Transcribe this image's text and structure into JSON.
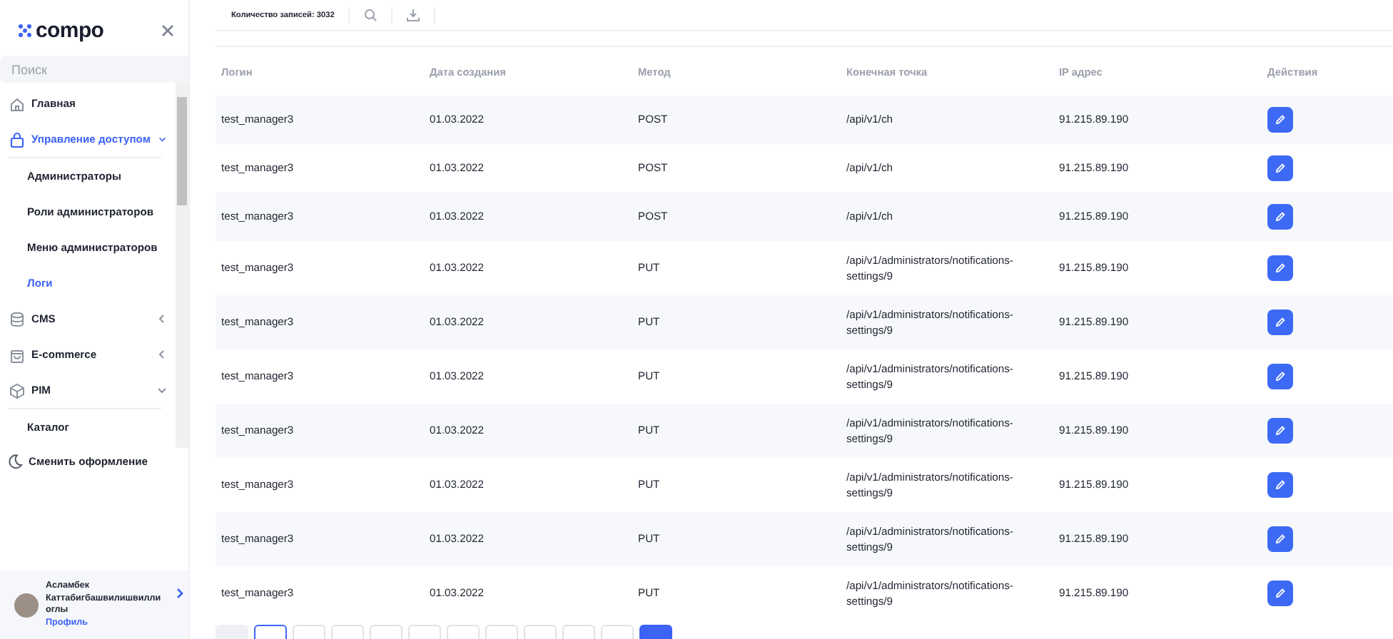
{
  "sidebar": {
    "logo": "compo",
    "search": {
      "placeholder": "Поиск"
    },
    "items": [
      {
        "label": "Главная",
        "selected": false
      },
      {
        "label": "Управление доступом",
        "selected": true,
        "expanded": true,
        "children": [
          {
            "label": "Администраторы",
            "selected": false
          },
          {
            "label": "Роли администраторов",
            "selected": false
          },
          {
            "label": "Меню администраторов",
            "selected": false
          },
          {
            "label": "Логи",
            "selected": true
          }
        ]
      },
      {
        "label": "CMS",
        "selected": false,
        "expanded": false
      },
      {
        "label": "E-commerce",
        "selected": false,
        "expanded": false
      },
      {
        "label": "PIM",
        "selected": false,
        "expanded": true,
        "children": [
          {
            "label": "Каталог",
            "selected": false
          }
        ]
      }
    ],
    "theme_toggle": "Сменить оформление",
    "profile": {
      "name": "Асламбек Каттабигбашвилишвилли оглы",
      "link": "Профиль"
    }
  },
  "toolbar": {
    "record_count": "Количество записей: 3032"
  },
  "table": {
    "columns": [
      "Логин",
      "Дата создания",
      "Метод",
      "Конечная точка",
      "IP адрес",
      "Действия"
    ],
    "rows": [
      [
        "test_manager3",
        "01.03.2022",
        "POST",
        "/api/v1/ch",
        "91.215.89.190"
      ],
      [
        "test_manager3",
        "01.03.2022",
        "POST",
        "/api/v1/ch",
        "91.215.89.190"
      ],
      [
        "test_manager3",
        "01.03.2022",
        "POST",
        "/api/v1/ch",
        "91.215.89.190"
      ],
      [
        "test_manager3",
        "01.03.2022",
        "PUT",
        "/api/v1/administrators/notifications-settings/9",
        "91.215.89.190"
      ],
      [
        "test_manager3",
        "01.03.2022",
        "PUT",
        "/api/v1/administrators/notifications-settings/9",
        "91.215.89.190"
      ],
      [
        "test_manager3",
        "01.03.2022",
        "PUT",
        "/api/v1/administrators/notifications-settings/9",
        "91.215.89.190"
      ],
      [
        "test_manager3",
        "01.03.2022",
        "PUT",
        "/api/v1/administrators/notifications-settings/9",
        "91.215.89.190"
      ],
      [
        "test_manager3",
        "01.03.2022",
        "PUT",
        "/api/v1/administrators/notifications-settings/9",
        "91.215.89.190"
      ],
      [
        "test_manager3",
        "01.03.2022",
        "PUT",
        "/api/v1/administrators/notifications-settings/9",
        "91.215.89.190"
      ],
      [
        "test_manager3",
        "01.03.2022",
        "PUT",
        "/api/v1/administrators/notifications-settings/9",
        "91.215.89.190"
      ]
    ]
  },
  "pagination": [
    {
      "kind": "prev"
    },
    {
      "kind": "page",
      "selected": true
    },
    {
      "kind": "page",
      "selected": false
    },
    {
      "kind": "page",
      "selected": false
    },
    {
      "kind": "page",
      "selected": false
    },
    {
      "kind": "page",
      "selected": false
    },
    {
      "kind": "page",
      "selected": false
    },
    {
      "kind": "page",
      "selected": false
    },
    {
      "kind": "page",
      "selected": false
    },
    {
      "kind": "page",
      "selected": false
    },
    {
      "kind": "page",
      "selected": false
    },
    {
      "kind": "next"
    }
  ]
}
